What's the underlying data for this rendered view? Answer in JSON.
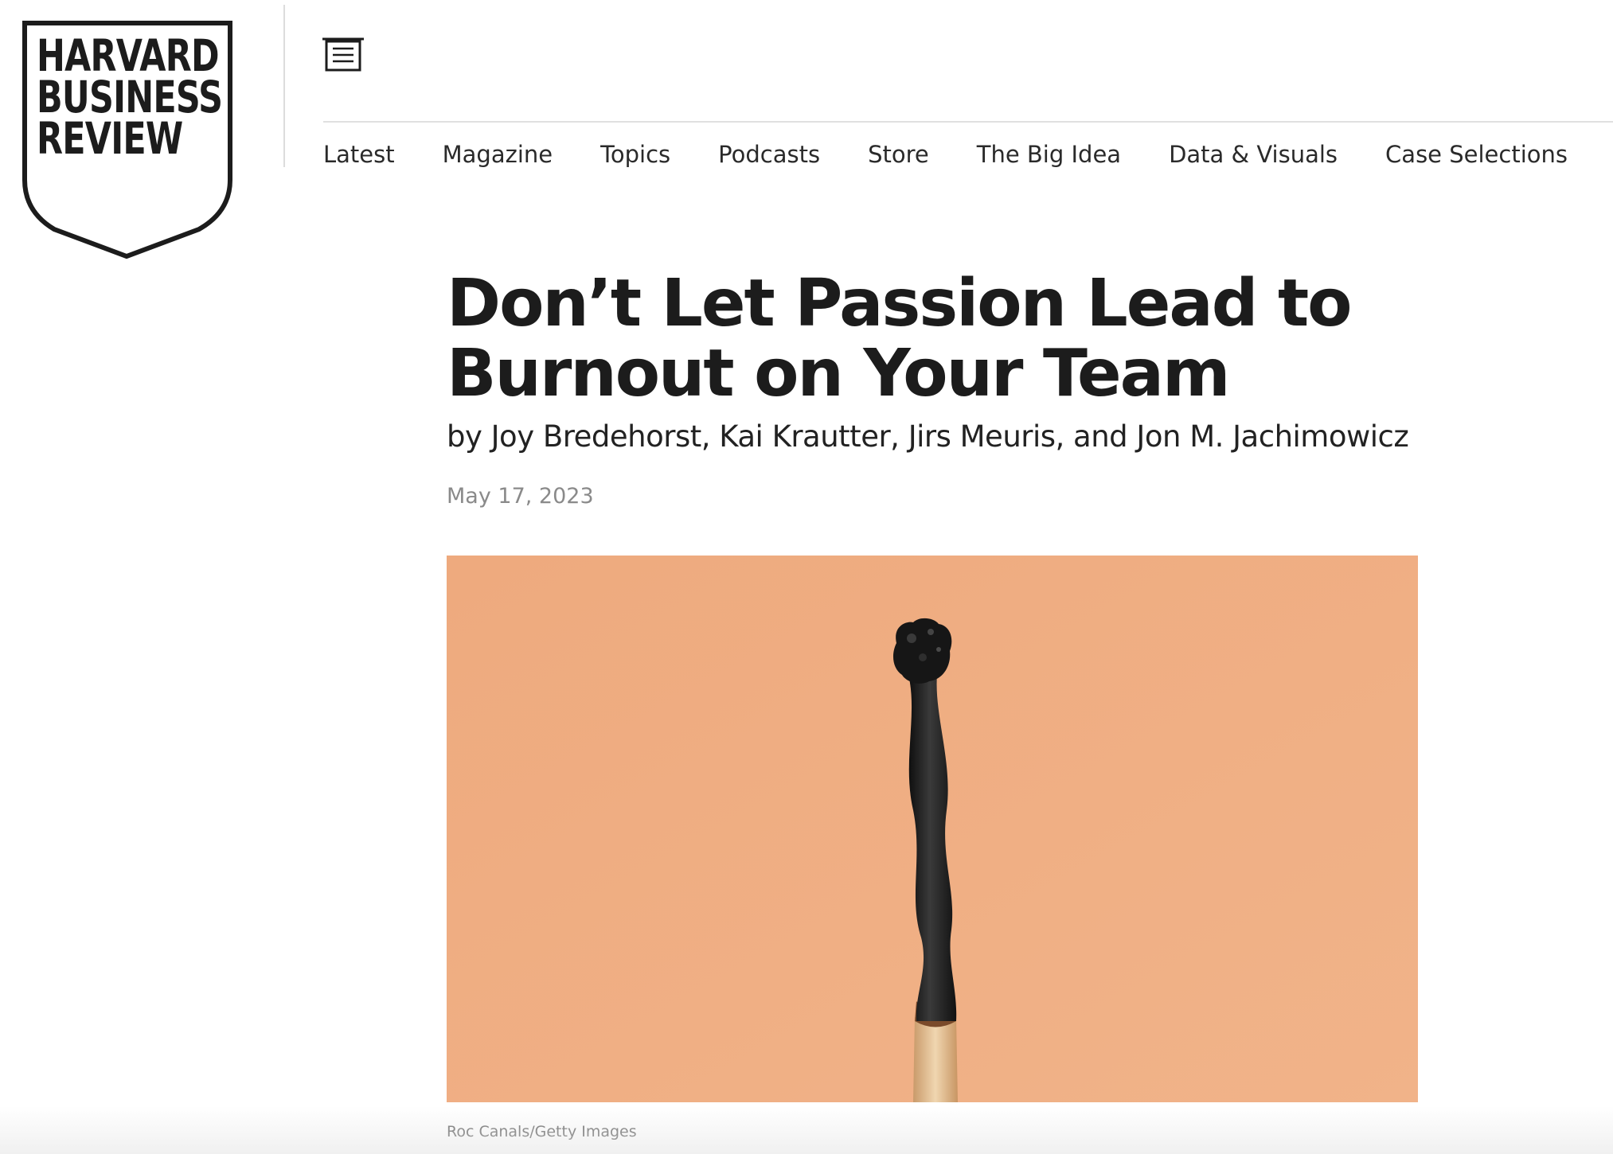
{
  "logo": {
    "lines": [
      "HARVARD",
      "BUSINESS",
      "REVIEW"
    ]
  },
  "header": {
    "menu_icon": "menu-icon"
  },
  "nav": {
    "items": [
      "Latest",
      "Magazine",
      "Topics",
      "Podcasts",
      "Store",
      "The Big Idea",
      "Data & Visuals",
      "Case Selections"
    ]
  },
  "article": {
    "title": "Don’t Let Passion Lead to Burnout on Your Team",
    "byline": "by Joy Bredehorst, Kai Krautter, Jirs Meuris, and Jon M. Jachimowicz",
    "date": "May 17, 2023",
    "image_credit": "Roc Canals/Getty Images"
  },
  "colors": {
    "hero_background": "#efae83",
    "text": "#1c1c1c",
    "date": "#8a8a8a"
  }
}
